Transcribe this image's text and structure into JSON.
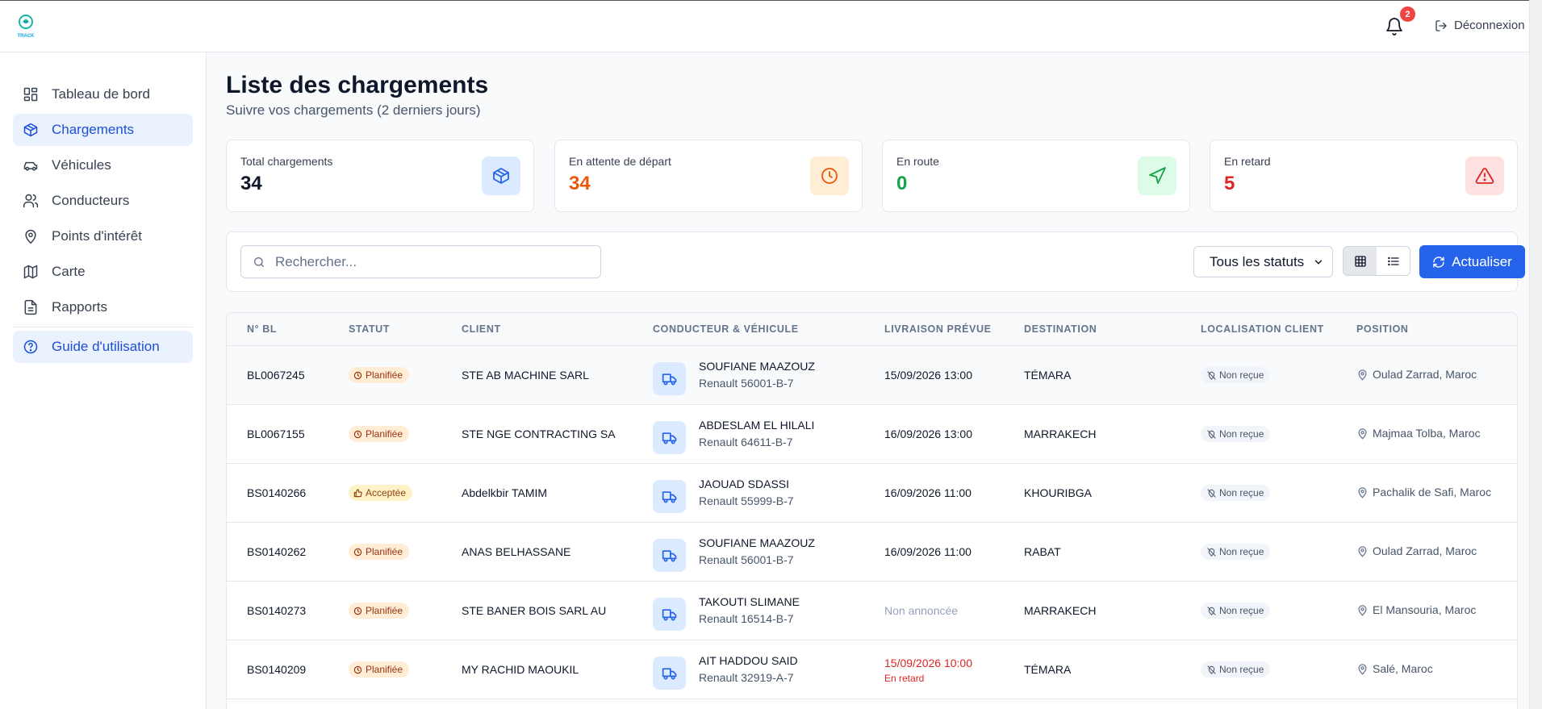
{
  "header": {
    "logo_text": "TRACK",
    "notification_count": "2",
    "logout_label": "Déconnexion"
  },
  "sidebar": {
    "items": [
      {
        "label": "Tableau de bord",
        "icon": "dashboard-icon"
      },
      {
        "label": "Chargements",
        "icon": "package-icon"
      },
      {
        "label": "Véhicules",
        "icon": "car-icon"
      },
      {
        "label": "Conducteurs",
        "icon": "users-icon"
      },
      {
        "label": "Points d'intérêt",
        "icon": "map-pin-icon"
      },
      {
        "label": "Carte",
        "icon": "map-icon"
      },
      {
        "label": "Rapports",
        "icon": "file-text-icon"
      }
    ],
    "guide_label": "Guide d'utilisation"
  },
  "page": {
    "title": "Liste des chargements",
    "subtitle": "Suivre vos chargements (2 derniers jours)"
  },
  "stats": [
    {
      "label": "Total chargements",
      "value": "34",
      "color": "#0f172a",
      "icon": "package-icon"
    },
    {
      "label": "En attente de départ",
      "value": "34",
      "color": "#ea580c",
      "icon": "clock-icon"
    },
    {
      "label": "En route",
      "value": "0",
      "color": "#16a34a",
      "icon": "navigation-icon"
    },
    {
      "label": "En retard",
      "value": "5",
      "color": "#dc2626",
      "icon": "alert-triangle-icon"
    }
  ],
  "toolbar": {
    "search_placeholder": "Rechercher...",
    "status_filter": "Tous les statuts",
    "refresh_label": "Actualiser"
  },
  "table": {
    "columns": [
      "N° BL",
      "STATUT",
      "CLIENT",
      "CONDUCTEUR & VÉHICULE",
      "LIVRAISON PRÉVUE",
      "DESTINATION",
      "LOCALISATION CLIENT",
      "POSITION"
    ],
    "rows": [
      {
        "bl": "BL0067245",
        "status": "Planifiée",
        "client": "STE AB MACHINE SARL",
        "driver": "SOUFIANE MAAZOUZ",
        "vehicle": "Renault 56001-B-7",
        "delivery": "15/09/2026 13:00",
        "delivery_note": "",
        "destination": "TÉMARA",
        "localisation": "Non reçue",
        "position": "Oulad Zarrad, Maroc"
      },
      {
        "bl": "BL0067155",
        "status": "Planifiée",
        "client": "STE NGE CONTRACTING SA",
        "driver": "ABDESLAM EL HILALI",
        "vehicle": "Renault 64611-B-7",
        "delivery": "16/09/2026 13:00",
        "delivery_note": "",
        "destination": "MARRAKECH",
        "localisation": "Non reçue",
        "position": "Majmaa Tolba, Maroc"
      },
      {
        "bl": "BS0140266",
        "status": "Acceptée",
        "client": "Abdelkbir TAMIM",
        "driver": "JAOUAD SDASSI",
        "vehicle": "Renault 55999-B-7",
        "delivery": "16/09/2026 11:00",
        "delivery_note": "",
        "destination": "KHOURIBGA",
        "localisation": "Non reçue",
        "position": "Pachalik de Safi, Maroc"
      },
      {
        "bl": "BS0140262",
        "status": "Planifiée",
        "client": "ANAS BELHASSANE",
        "driver": "SOUFIANE MAAZOUZ",
        "vehicle": "Renault 56001-B-7",
        "delivery": "16/09/2026 11:00",
        "delivery_note": "",
        "destination": "RABAT",
        "localisation": "Non reçue",
        "position": "Oulad Zarrad, Maroc"
      },
      {
        "bl": "BS0140273",
        "status": "Planifiée",
        "client": "STE BANER BOIS SARL AU",
        "driver": "TAKOUTI SLIMANE",
        "vehicle": "Renault 16514-B-7",
        "delivery": "Non annoncée",
        "delivery_note": "",
        "destination": "MARRAKECH",
        "localisation": "Non reçue",
        "position": "El Mansouria, Maroc"
      },
      {
        "bl": "BS0140209",
        "status": "Planifiée",
        "client": "MY RACHID MAOUKIL",
        "driver": "AIT HADDOU SAID",
        "vehicle": "Renault 32919-A-7",
        "delivery": "15/09/2026 10:00",
        "delivery_note": "En retard",
        "destination": "TÉMARA",
        "localisation": "Non reçue",
        "position": "Salé, Maroc"
      }
    ]
  },
  "colors": {
    "accent": "#2563eb",
    "active_nav_bg": "#eaf2fe",
    "danger": "#dc2626",
    "warning": "#ea580c",
    "success": "#16a34a"
  }
}
